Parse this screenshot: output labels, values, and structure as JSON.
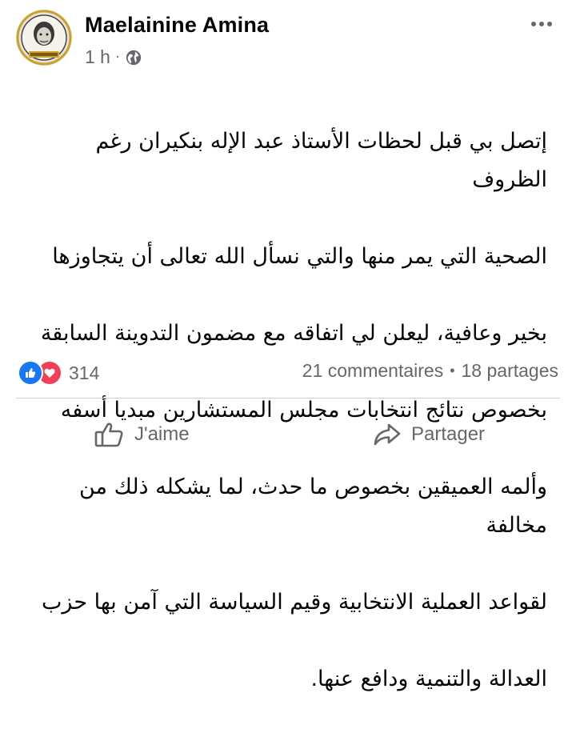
{
  "post": {
    "author": "Maelainine Amina",
    "time": "1 h",
    "separator": "·",
    "privacy_icon": "globe-icon",
    "text_lines": [
      "إتصل بي قبل لحظات الأستاذ عبد الإله بنكيران رغم الظروف",
      "الصحية التي يمر منها والتي نسأل الله تعالى أن يتجاوزها",
      "بخير وعافية، ليعلن لي اتفاقه مع مضمون التدوينة السابقة",
      "بخصوص نتائج انتخابات مجلس المستشارين مبديا أسفه",
      "وألمه العميقين بخصوص ما حدث، لما يشكله ذلك من مخالفة",
      "لقواعد العملية الانتخابية وقيم السياسة التي آمن بها حزب",
      "العدالة والتنمية ودافع عنها."
    ]
  },
  "reactions": {
    "count": "314",
    "icons": [
      "like-icon",
      "love-icon"
    ]
  },
  "stats": {
    "comments": "21 commentaires",
    "separator": "•",
    "shares": "18 partages"
  },
  "actions": {
    "like_label": "J'aime",
    "share_label": "Partager"
  },
  "colors": {
    "like_blue": "#1877f2",
    "love_red": "#f33e58",
    "secondary_text": "#65676b"
  }
}
